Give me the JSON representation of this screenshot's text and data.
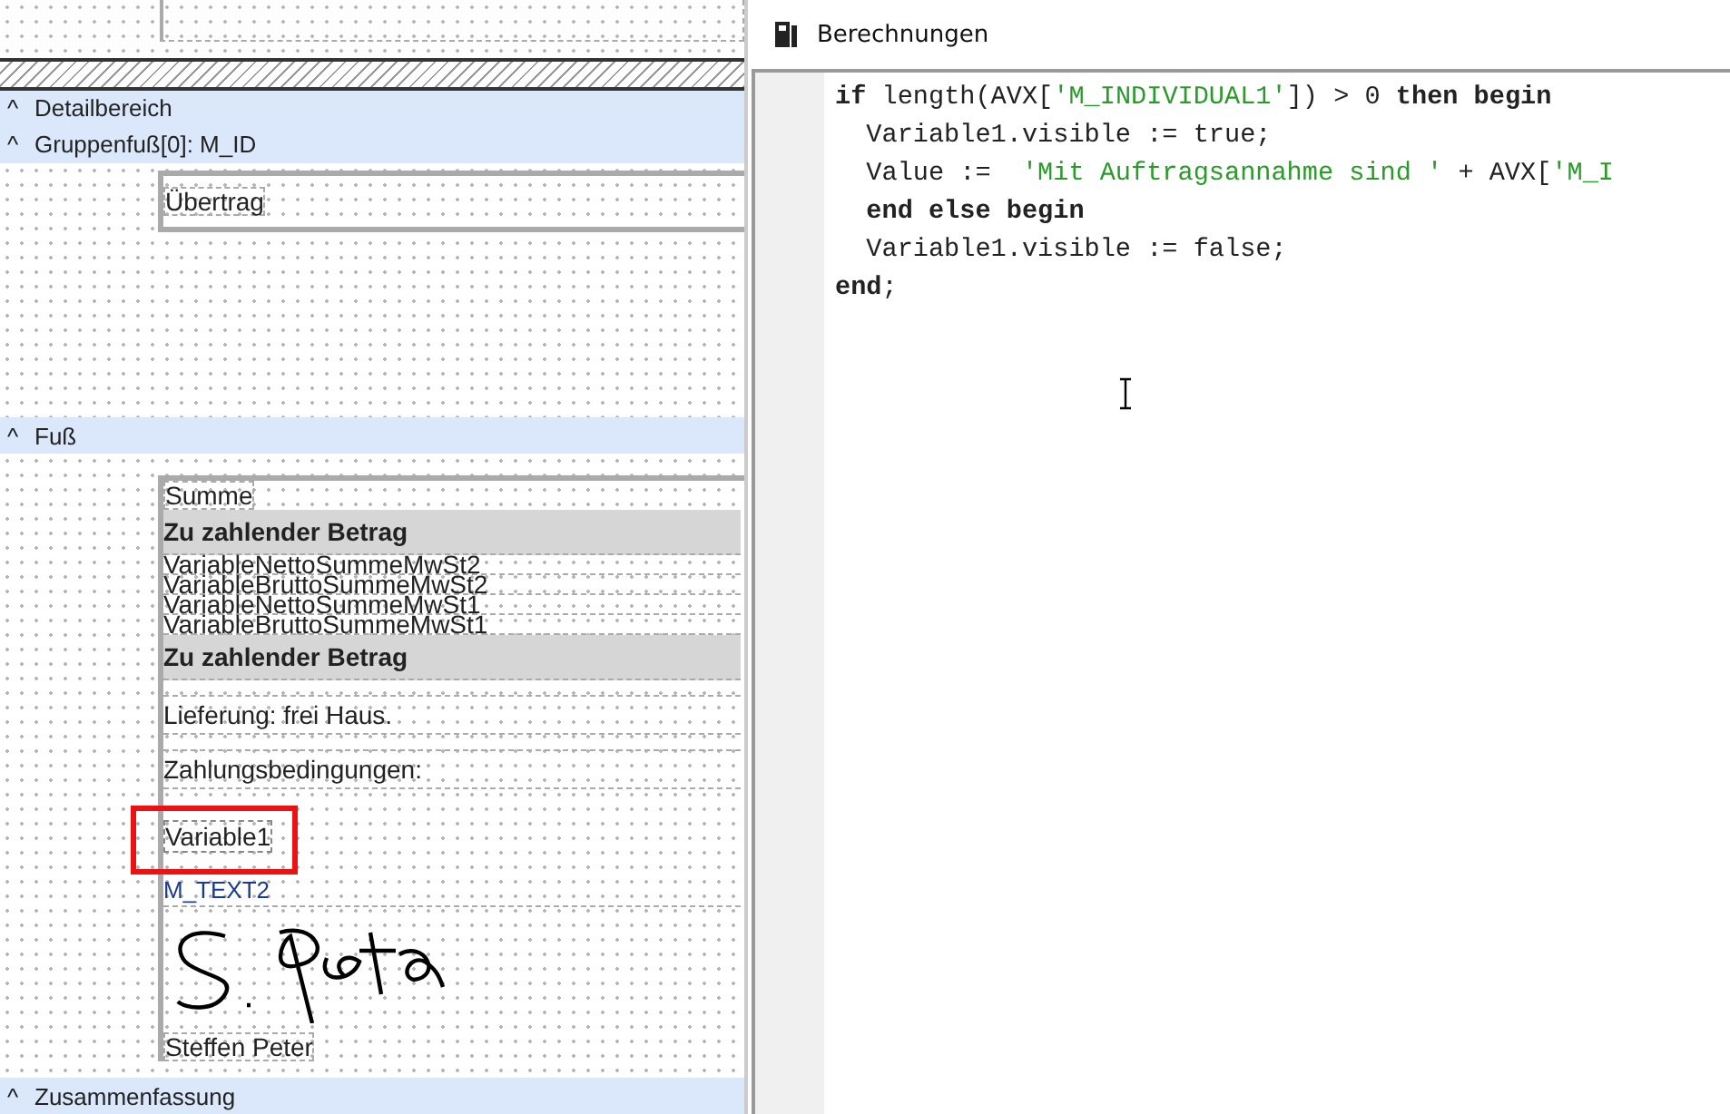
{
  "designer": {
    "bands": [
      {
        "toggle": "^",
        "title": "Detailbereich"
      },
      {
        "toggle": "^",
        "title": "Gruppenfuß[0]: M_ID",
        "items": [
          {
            "kind": "label",
            "text": "Übertrag"
          }
        ]
      },
      {
        "toggle": "^",
        "title": "Fuß",
        "items": [
          {
            "kind": "label",
            "text": "Summe"
          },
          {
            "kind": "total",
            "text": "Zu zahlender Betrag"
          },
          {
            "kind": "variable",
            "text": "VariableNettoSummeMwSt2"
          },
          {
            "kind": "variable",
            "text": "VariableBruttoSummeMwSt2"
          },
          {
            "kind": "variable",
            "text": "VariableNettoSummeMwSt1"
          },
          {
            "kind": "variable",
            "text": "VariableBruttoSummeMwSt1"
          },
          {
            "kind": "total",
            "text": "Zu zahlender Betrag"
          },
          {
            "kind": "note",
            "text": "Lieferung: frei Haus."
          },
          {
            "kind": "note",
            "text": "Zahlungsbedingungen:"
          },
          {
            "kind": "selected",
            "text": "Variable1"
          },
          {
            "kind": "datafield",
            "text": "M_TEXT2"
          },
          {
            "kind": "signature"
          },
          {
            "kind": "label",
            "text": "Steffen Peter"
          }
        ]
      },
      {
        "toggle": "^",
        "title": "Zusammenfassung"
      }
    ]
  },
  "editor": {
    "title": "Berechnungen",
    "lines": [
      {
        "indented": false,
        "tokens": [
          {
            "kind": "keyword",
            "text": "if"
          },
          {
            "kind": "plain",
            "text": " length(AVX["
          },
          {
            "kind": "string",
            "text": "'M_INDIVIDUAL1'"
          },
          {
            "kind": "plain",
            "text": "]) > 0 "
          },
          {
            "kind": "keyword",
            "text": "then begin"
          }
        ]
      },
      {
        "indented": true,
        "tokens": [
          {
            "kind": "plain",
            "text": "Variable1.visible := true;"
          }
        ]
      },
      {
        "indented": true,
        "tokens": [
          {
            "kind": "plain",
            "text": "Value :=  "
          },
          {
            "kind": "string",
            "text": "'Mit Auftragsannahme sind '"
          },
          {
            "kind": "plain",
            "text": " + AVX["
          },
          {
            "kind": "string",
            "text": "'M_I"
          }
        ]
      },
      {
        "indented": true,
        "tokens": [
          {
            "kind": "keyword",
            "text": "end else begin"
          }
        ]
      },
      {
        "indented": true,
        "tokens": [
          {
            "kind": "plain",
            "text": "Variable1.visible := false;"
          }
        ]
      },
      {
        "indented": false,
        "tokens": [
          {
            "kind": "keyword",
            "text": "end"
          },
          {
            "kind": "plain",
            "text": ";"
          }
        ]
      }
    ]
  }
}
